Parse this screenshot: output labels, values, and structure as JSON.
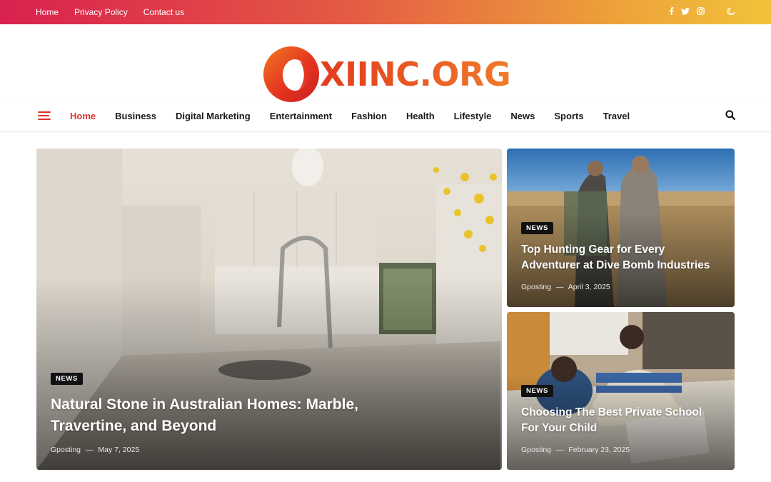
{
  "topbar": {
    "links": [
      "Home",
      "Privacy Policy",
      "Contact us"
    ],
    "social_icons": [
      "facebook-icon",
      "twitter-icon",
      "instagram-icon"
    ],
    "theme_icon": "moon-icon"
  },
  "brand": {
    "logo_text": "XIINC.ORG",
    "color": "#e94b22"
  },
  "nav": {
    "items": [
      "Home",
      "Business",
      "Digital Marketing",
      "Entertainment",
      "Fashion",
      "Health",
      "Lifestyle",
      "News",
      "Sports",
      "Travel"
    ],
    "active": "Home",
    "accent": "#e0332c"
  },
  "featured": {
    "main": {
      "badge": "NEWS",
      "title_line1": "Natural Stone in Australian Homes: Marble,",
      "title_line2": "Travertine, and Beyond",
      "author": "Gposting",
      "sep": "—",
      "date": "May 7, 2025"
    },
    "side1": {
      "badge": "NEWS",
      "title_line1": "Top Hunting Gear for Every",
      "title_line2": "Adventurer at Dive Bomb Industries",
      "author": "Gposting",
      "sep": "—",
      "date": "April 3, 2025"
    },
    "side2": {
      "badge": "NEWS",
      "title_line1": "Choosing The Best Private School",
      "title_line2": "For Your Child",
      "author": "Gposting",
      "sep": "—",
      "date": "February 23, 2025"
    }
  }
}
